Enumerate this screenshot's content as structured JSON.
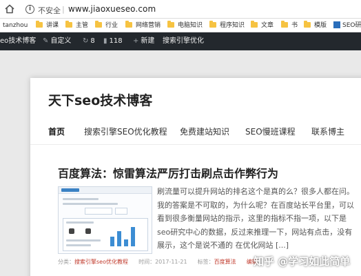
{
  "browser": {
    "security_label": "不安全",
    "separator": "|",
    "url": "www.jiaoxueseo.com"
  },
  "bookmarks": [
    {
      "label": "tanzhou",
      "icon": "page-icon"
    },
    {
      "label": "讲课",
      "icon": "folder-icon"
    },
    {
      "label": "主管",
      "icon": "folder-icon"
    },
    {
      "label": "行业",
      "icon": "folder-icon"
    },
    {
      "label": "网络营销",
      "icon": "folder-icon"
    },
    {
      "label": "电脑知识",
      "icon": "folder-icon"
    },
    {
      "label": "程序知识",
      "icon": "folder-icon"
    },
    {
      "label": "文章",
      "icon": "folder-icon"
    },
    {
      "label": "书",
      "icon": "folder-icon"
    },
    {
      "label": "模版",
      "icon": "folder-icon"
    },
    {
      "label": "SEO研",
      "icon": "app-icon"
    }
  ],
  "admin_bar": {
    "site_name": "eo技术博客",
    "customize": "自定义",
    "updates_count": "8",
    "comments_count": "118",
    "new_label": "新建",
    "seo_label": "搜索引擎优化"
  },
  "site": {
    "title": "天下seo技术博客",
    "nav": [
      "首页",
      "搜索引擎SEO优化教程",
      "免费建站知识",
      "SEO慢班课程",
      "联系博主"
    ]
  },
  "post": {
    "title": "百度算法：惊雷算法严厉打击刷点击作弊行为",
    "excerpt_lines": [
      "刷流量可以提升网站的排名这个是真的么？很多人都在问。",
      "我的答案是不可取的，为什么呢？在百度站长平台里，可以",
      "看到很多衡量网站的指示，这里的指标不指一项，以下是",
      "seo研究中心的数据，反过来推理一下，网站有点击，没有",
      "展示，这个是说不通的 在优化网站 [...]"
    ],
    "meta": {
      "category_label": "分类：",
      "category": "搜索引擎seo优化教程",
      "time_label": "时间：",
      "time": "2017-11-21",
      "tags_label": "标签：",
      "tag": "百度算法",
      "edit": "编辑"
    }
  },
  "watermark": "知乎 @学习如此简单",
  "colors": {
    "admin_bar_bg": "#23282d",
    "link_red": "#c0392b",
    "folder_yellow": "#f6c342"
  }
}
